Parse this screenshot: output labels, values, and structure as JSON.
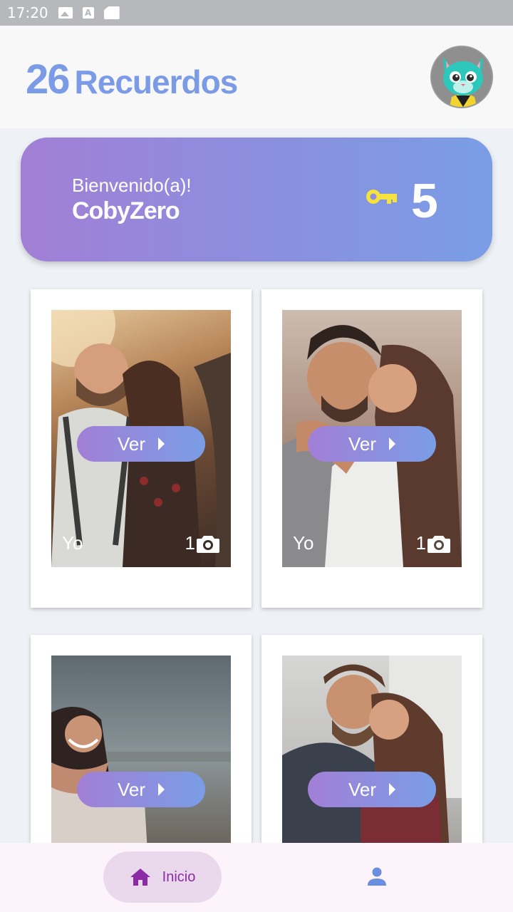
{
  "status_bar": {
    "time": "17:20",
    "icons": [
      "image-icon",
      "font-icon",
      "sd-card-icon"
    ]
  },
  "header": {
    "count": "26",
    "title": "Recuerdos",
    "avatar": "cat-avatar"
  },
  "welcome": {
    "greeting": "Bienvenido(a)!",
    "username": "CobyZero",
    "key_icon": "key-icon",
    "keys": "5"
  },
  "cards": [
    {
      "button": "Ver",
      "owner": "Yo",
      "photos": "1",
      "photo_icon": "camera-icon"
    },
    {
      "button": "Ver",
      "owner": "Yo",
      "photos": "1",
      "photo_icon": "camera-icon"
    },
    {
      "button": "Ver"
    },
    {
      "button": "Ver"
    }
  ],
  "bottom_nav": {
    "home_label": "Inicio",
    "home_icon": "home-icon",
    "profile_icon": "person-icon"
  },
  "colors": {
    "accent": "#7b9be6",
    "gradient_start": "#a27fd6",
    "gradient_end": "#7a9de6",
    "key": "#f6e23c",
    "nav_active": "#8b2ca6"
  }
}
